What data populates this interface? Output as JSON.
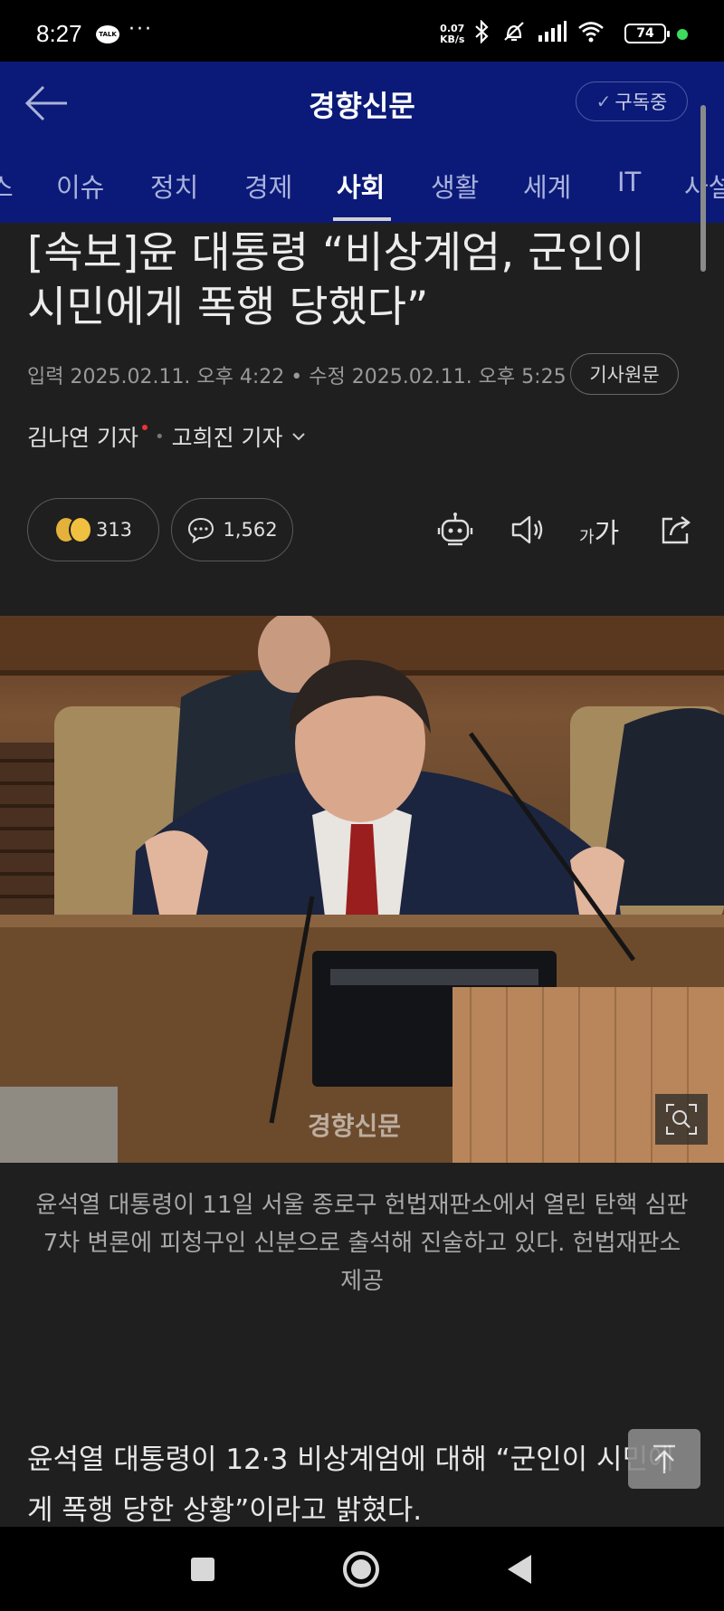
{
  "status_bar": {
    "time": "8:27",
    "talk_badge": "TALK",
    "more": "···",
    "net_speed_value": "0.07",
    "net_speed_unit": "KB/s",
    "battery": "74"
  },
  "header": {
    "title": "경향신문",
    "subscribe_label": "구독중"
  },
  "tabs": [
    {
      "label": "스"
    },
    {
      "label": "이슈"
    },
    {
      "label": "정치"
    },
    {
      "label": "경제"
    },
    {
      "label": "사회"
    },
    {
      "label": "생활"
    },
    {
      "label": "세계"
    },
    {
      "label": "IT"
    },
    {
      "label": "사설"
    }
  ],
  "active_tab": "사회",
  "article": {
    "headline": "[속보]윤 대통령 “비상계엄, 군인이 시민에게 폭행 당했다”",
    "dates": "입력 2025.02.11. 오후 4:22 • 수정 2025.02.11. 오후 5:25",
    "original_label": "기사원문",
    "reporter_1": "김나연 기자",
    "reporter_2": "고희진 기자",
    "reaction_count": "313",
    "comment_count": "1,562",
    "font_small": "가",
    "font_large": "가",
    "photo_watermark": "경향신문",
    "caption": "윤석열 대통령이 11일 서울 종로구 헌법재판소에서 열린 탄핵 심판 7차 변론에 피청구인 신분으로 출석해 진술하고 있다. 헌법재판소 제공",
    "body": "윤석열 대통령이 12·3 비상계엄에 대해 “군인이 시민에게 폭행 당한 상황”이라고 밝혔다."
  },
  "colors": {
    "header_bg": "#0b1a78",
    "page_bg": "#1f1f1f",
    "accent_red": "#ee3333"
  }
}
